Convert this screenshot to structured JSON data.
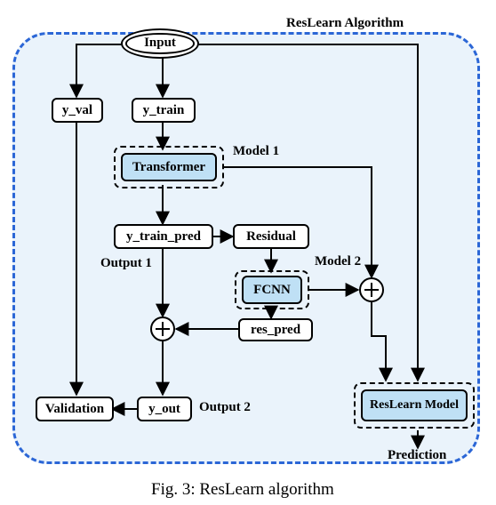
{
  "title": "ResLearn Algorithm",
  "caption": "Fig. 3: ResLearn algorithm",
  "nodes": {
    "input": "Input",
    "y_val": "y_val",
    "y_train": "y_train",
    "transformer": "Transformer",
    "y_train_pred": "y_train_pred",
    "residual": "Residual",
    "fcnn": "FCNN",
    "res_pred": "res_pred",
    "y_out": "y_out",
    "validation": "Validation",
    "reslearn_model": "ResLearn Model"
  },
  "labels": {
    "model1": "Model 1",
    "model2": "Model 2",
    "output1": "Output 1",
    "output2": "Output 2",
    "prediction": "Prediction"
  },
  "chart_data": {
    "type": "flow-diagram",
    "title": "ResLearn Algorithm",
    "nodes": [
      {
        "id": "input",
        "label": "Input",
        "kind": "start"
      },
      {
        "id": "y_val",
        "label": "y_val",
        "kind": "data"
      },
      {
        "id": "y_train",
        "label": "y_train",
        "kind": "data"
      },
      {
        "id": "transformer",
        "label": "Transformer",
        "kind": "model",
        "group": "Model 1"
      },
      {
        "id": "y_train_pred",
        "label": "y_train_pred",
        "kind": "data"
      },
      {
        "id": "residual",
        "label": "Residual",
        "kind": "op"
      },
      {
        "id": "fcnn",
        "label": "FCNN",
        "kind": "model",
        "group": "Model 2"
      },
      {
        "id": "res_pred",
        "label": "res_pred",
        "kind": "data"
      },
      {
        "id": "sum1",
        "label": "⊕",
        "kind": "sum"
      },
      {
        "id": "y_out",
        "label": "y_out",
        "kind": "data",
        "tag": "Output 2"
      },
      {
        "id": "validation",
        "label": "Validation",
        "kind": "op"
      },
      {
        "id": "sum2",
        "label": "⊕",
        "kind": "sum"
      },
      {
        "id": "reslearn_model",
        "label": "ResLearn Model",
        "kind": "model-composite"
      },
      {
        "id": "prediction",
        "label": "Prediction",
        "kind": "output"
      }
    ],
    "edges": [
      {
        "from": "input",
        "to": "y_val"
      },
      {
        "from": "input",
        "to": "y_train"
      },
      {
        "from": "input",
        "to": "reslearn_model"
      },
      {
        "from": "y_train",
        "to": "transformer"
      },
      {
        "from": "transformer",
        "to": "y_train_pred",
        "tag": "Output 1"
      },
      {
        "from": "transformer",
        "to": "sum2"
      },
      {
        "from": "y_train_pred",
        "to": "residual"
      },
      {
        "from": "y_train_pred",
        "to": "sum1"
      },
      {
        "from": "residual",
        "to": "fcnn"
      },
      {
        "from": "fcnn",
        "to": "res_pred"
      },
      {
        "from": "fcnn",
        "to": "sum2"
      },
      {
        "from": "res_pred",
        "to": "sum1"
      },
      {
        "from": "sum1",
        "to": "y_out"
      },
      {
        "from": "y_out",
        "to": "validation"
      },
      {
        "from": "y_val",
        "to": "validation"
      },
      {
        "from": "sum2",
        "to": "reslearn_model"
      },
      {
        "from": "reslearn_model",
        "to": "prediction"
      }
    ]
  }
}
